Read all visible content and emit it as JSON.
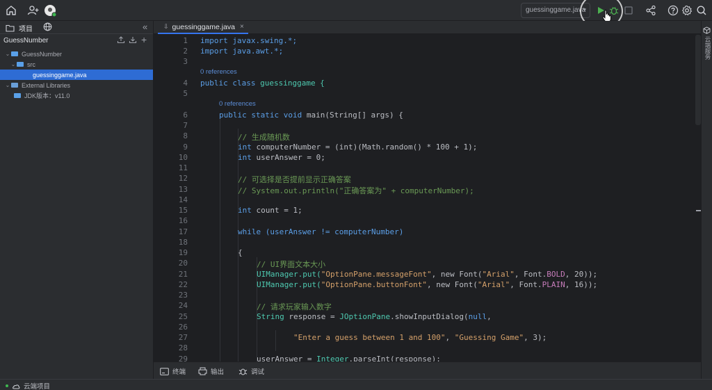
{
  "topbar": {
    "run_config": "guessinggame.java",
    "icons": [
      "home-icon",
      "add-user-icon",
      "avatar",
      "run-icon",
      "debug-icon",
      "stop-icon",
      "share-icon",
      "help-icon",
      "settings-icon",
      "search-icon"
    ],
    "accent_color": "#3574f0",
    "run_color": "#4caf50"
  },
  "left_panel": {
    "tab_project": "项目",
    "root_title": "GuessNumber",
    "tree": [
      {
        "label": "GuessNumber",
        "type": "folder",
        "expanded": true
      },
      {
        "label": "src",
        "type": "folder",
        "expanded": true
      },
      {
        "label": "guessinggame.java",
        "type": "file",
        "selected": true
      },
      {
        "label": "External Libraries",
        "type": "library",
        "expanded": true
      },
      {
        "label": "JDK版本：v11.0",
        "type": "folder"
      }
    ]
  },
  "editor": {
    "tab_label": "guessinggame.java",
    "hint_label": "0 references",
    "line_numbers": [
      "1",
      "2",
      "3",
      "4",
      "5",
      "6",
      "7",
      "8",
      "9",
      "10",
      "11",
      "12",
      "13",
      "14",
      "15",
      "16",
      "17",
      "18",
      "19",
      "20",
      "21",
      "22",
      "23",
      "24",
      "25",
      "26",
      "27",
      "28",
      "29"
    ],
    "lines": {
      "l1": "import javax.swing.*;",
      "l2": "import java.awt.*;",
      "l4a": "public class ",
      "l4b": "guessinggame {",
      "l6a": "public static void ",
      "l6b": "main(String[] args) {",
      "l8": "// 生成随机数",
      "l9": "computerNumber = (int)(Math.random() * 100 + 1);",
      "l10": "userAnswer = 0;",
      "l12": "// 可选择是否提前显示正确答案",
      "l13": "// System.out.println(\"正确答案为\" + computerNumber);",
      "l15": "count = 1;",
      "l17": "while (userAnswer != computerNumber)",
      "l19": "{",
      "l20": "// UI界面文本大小",
      "l21a": "UIManager.put(",
      "l21b": "\"OptionPane.messageFont\"",
      "l21c": ", new Font(",
      "l21d": "\"Arial\"",
      "l21e": ", Font.",
      "l21f": "BOLD",
      "l21g": ", 20));",
      "l22b": "\"OptionPane.buttonFont\"",
      "l22f": "PLAIN",
      "l22g": ", 16));",
      "l24": "// 请求玩家输入数字",
      "l25a": "String ",
      "l25b": "response = ",
      "l25c": "JOptionPane",
      "l25d": ".showInputDialog(",
      "l25e": "null",
      "l25f": ",",
      "l27a": "\"Enter a guess between 1 and 100\"",
      "l27b": ", ",
      "l27c": "\"Guessing Game\"",
      "l27d": ", 3);",
      "l29a": "userAnswer = ",
      "l29b": "Integer",
      "l29c": ".parseInt(response);"
    }
  },
  "right_strip": {
    "label": "云端服务"
  },
  "bottom_tools": [
    {
      "label": "终端",
      "icon": "terminal-icon"
    },
    {
      "label": "输出",
      "icon": "printer-icon"
    },
    {
      "label": "调试",
      "icon": "bug-icon"
    }
  ],
  "status": {
    "cloud_label": "云端项目"
  }
}
